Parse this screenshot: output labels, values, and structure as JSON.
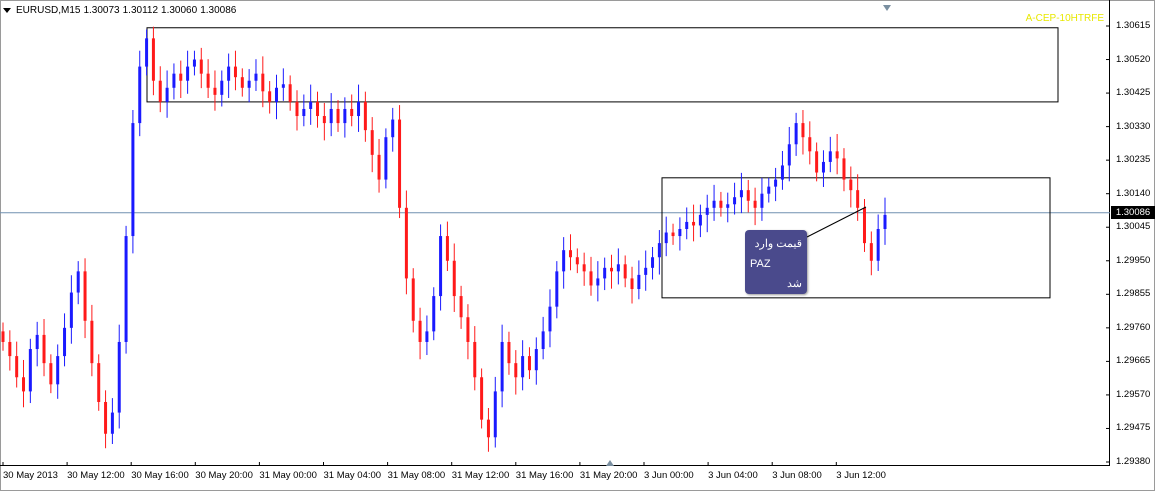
{
  "header": {
    "symbol": "EURUSD,M15",
    "open": "1.30073",
    "high": "1.30112",
    "low": "1.30060",
    "close": "1.30086"
  },
  "indicator_label": "A-CEP-10HTRFE",
  "current_price": "1.30086",
  "note": {
    "line1": "قیمت وارد",
    "line2": "PAZ",
    "line3": "شد"
  },
  "colors": {
    "bull": "#1a1aff",
    "bear": "#ff1a1a",
    "neutral": "#1aaa1a",
    "price_line": "#7090b0",
    "note_bg": "#4a4a8c"
  },
  "chart_data": {
    "type": "candlestick",
    "ylim": [
      1.2938,
      1.3064
    ],
    "y_ticks": [
      "1.30615",
      "1.30520",
      "1.30425",
      "1.30330",
      "1.30235",
      "1.30140",
      "1.30045",
      "1.29950",
      "1.29855",
      "1.29760",
      "1.29665",
      "1.29570",
      "1.29475",
      "1.29380"
    ],
    "x_ticks": [
      "30 May 2013",
      "30 May 12:00",
      "30 May 16:00",
      "30 May 20:00",
      "31 May 00:00",
      "31 May 04:00",
      "31 May 08:00",
      "31 May 12:00",
      "31 May 16:00",
      "31 May 20:00",
      "3 Jun 00:00",
      "3 Jun 04:00",
      "3 Jun 08:00",
      "3 Jun 12:00"
    ],
    "grid": false,
    "horizontal_line": 1.30086,
    "zones": [
      {
        "name": "upper-zone",
        "top": 1.3061,
        "bottom": 1.304
      },
      {
        "name": "lower-zone",
        "top": 1.30185,
        "bottom": 1.29845
      }
    ],
    "series_close": [
      1.2972,
      1.2968,
      1.2962,
      1.2958,
      1.297,
      1.2974,
      1.2966,
      1.296,
      1.2968,
      1.2976,
      1.2986,
      1.2992,
      1.2978,
      1.2966,
      1.2955,
      1.2946,
      1.2952,
      1.2972,
      1.3002,
      1.3034,
      1.305,
      1.3058,
      1.3046,
      1.304,
      1.3044,
      1.3048,
      1.3046,
      1.305,
      1.3052,
      1.3048,
      1.3044,
      1.3042,
      1.3046,
      1.305,
      1.3047,
      1.3044,
      1.3046,
      1.3048,
      1.3043,
      1.304,
      1.3044,
      1.3045,
      1.304,
      1.3036,
      1.3038,
      1.304,
      1.3036,
      1.3034,
      1.3038,
      1.3034,
      1.3038,
      1.3036,
      1.304,
      1.3032,
      1.3025,
      1.3018,
      1.303,
      1.3035,
      1.301,
      1.299,
      1.2978,
      1.2972,
      1.2975,
      1.2985,
      1.3002,
      1.2995,
      1.2985,
      1.2979,
      1.2972,
      1.2962,
      1.295,
      1.2945,
      1.2958,
      1.2972,
      1.2966,
      1.2962,
      1.2968,
      1.2964,
      1.297,
      1.2975,
      1.2982,
      1.2992,
      1.2998,
      1.2996,
      1.2994,
      1.2992,
      1.2988,
      1.299,
      1.2993,
      1.2992,
      1.2994,
      1.299,
      1.2987,
      1.2991,
      1.2993,
      1.2996,
      1.3,
      1.3003,
      1.3002,
      1.3004,
      1.3006,
      1.3005,
      1.3008,
      1.301,
      1.3012,
      1.301,
      1.3011,
      1.3013,
      1.3015,
      1.3012,
      1.301,
      1.3014,
      1.3016,
      1.3018,
      1.3022,
      1.3028,
      1.3034,
      1.303,
      1.3026,
      1.302,
      1.3023,
      1.3026,
      1.3024,
      1.3018,
      1.3015,
      1.301,
      1.3,
      1.2995,
      1.3004,
      1.3008
    ]
  }
}
